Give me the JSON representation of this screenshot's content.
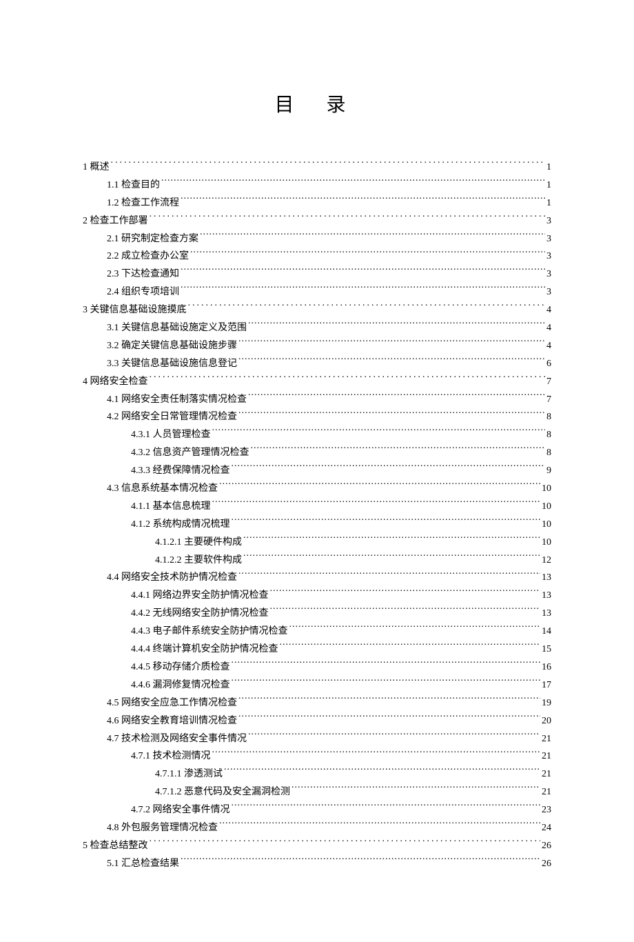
{
  "title": "目 录",
  "toc": [
    {
      "level": 0,
      "label": "1 概述",
      "page": "1"
    },
    {
      "level": 1,
      "label": "1.1 检查目的",
      "page": "1"
    },
    {
      "level": 1,
      "label": "1.2 检查工作流程",
      "page": "1"
    },
    {
      "level": 0,
      "label": "2 检查工作部署",
      "page": "3"
    },
    {
      "level": 1,
      "label": "2.1 研究制定检查方案",
      "page": "3"
    },
    {
      "level": 1,
      "label": "2.2 成立检查办公室",
      "page": "3"
    },
    {
      "level": 1,
      "label": "2.3 下达检查通知",
      "page": "3"
    },
    {
      "level": 1,
      "label": "2.4 组织专项培训",
      "page": "3"
    },
    {
      "level": 0,
      "label": "3 关键信息基础设施摸底",
      "page": "4"
    },
    {
      "level": 1,
      "label": "3.1 关键信息基础设施定义及范围",
      "page": "4"
    },
    {
      "level": 1,
      "label": "3.2 确定关键信息基础设施步骤",
      "page": "4"
    },
    {
      "level": 1,
      "label": "3.3 关键信息基础设施信息登记",
      "page": "6"
    },
    {
      "level": 0,
      "label": "4 网络安全检查",
      "page": "7"
    },
    {
      "level": 1,
      "label": "4.1 网络安全责任制落实情况检查",
      "page": "7"
    },
    {
      "level": 1,
      "label": "4.2 网络安全日常管理情况检查",
      "page": "8"
    },
    {
      "level": 2,
      "label": "4.3.1 人员管理检查",
      "page": "8"
    },
    {
      "level": 2,
      "label": "4.3.2 信息资产管理情况检查",
      "page": "8"
    },
    {
      "level": 2,
      "label": "4.3.3 经费保障情况检查",
      "page": "9"
    },
    {
      "level": 1,
      "label": "4.3 信息系统基本情况检查",
      "page": "10"
    },
    {
      "level": 2,
      "label": "4.1.1 基本信息梳理",
      "page": "10"
    },
    {
      "level": 2,
      "label": "4.1.2 系统构成情况梳理",
      "page": "10"
    },
    {
      "level": 3,
      "label": "4.1.2.1 主要硬件构成",
      "page": "10"
    },
    {
      "level": 3,
      "label": "4.1.2.2 主要软件构成",
      "page": "12"
    },
    {
      "level": 1,
      "label": "4.4 网络安全技术防护情况检查",
      "page": "13"
    },
    {
      "level": 2,
      "label": "4.4.1 网络边界安全防护情况检查",
      "page": "13"
    },
    {
      "level": 2,
      "label": "4.4.2 无线网络安全防护情况检查",
      "page": "13"
    },
    {
      "level": 2,
      "label": "4.4.3 电子邮件系统安全防护情况检查",
      "page": "14"
    },
    {
      "level": 2,
      "label": "4.4.4 终端计算机安全防护情况检查",
      "page": "15"
    },
    {
      "level": 2,
      "label": "4.4.5 移动存储介质检查",
      "page": "16"
    },
    {
      "level": 2,
      "label": "4.4.6 漏洞修复情况检查",
      "page": "17"
    },
    {
      "level": 1,
      "label": "4.5 网络安全应急工作情况检查",
      "page": "19"
    },
    {
      "level": 1,
      "label": "4.6 网络安全教育培训情况检查",
      "page": "20"
    },
    {
      "level": 1,
      "label": "4.7 技术检测及网络安全事件情况",
      "page": "21"
    },
    {
      "level": 2,
      "label": "4.7.1 技术检测情况",
      "page": "21"
    },
    {
      "level": 3,
      "label": "4.7.1.1 渗透测试",
      "page": "21"
    },
    {
      "level": 3,
      "label": "4.7.1.2 恶意代码及安全漏洞检测",
      "page": "21"
    },
    {
      "level": 2,
      "label": "4.7.2 网络安全事件情况",
      "page": "23"
    },
    {
      "level": 1,
      "label": "4.8 外包服务管理情况检查",
      "page": "24"
    },
    {
      "level": 0,
      "label": "5 检查总结整改",
      "page": "26"
    },
    {
      "level": 1,
      "label": "5.1 汇总检查结果",
      "page": "26"
    }
  ]
}
